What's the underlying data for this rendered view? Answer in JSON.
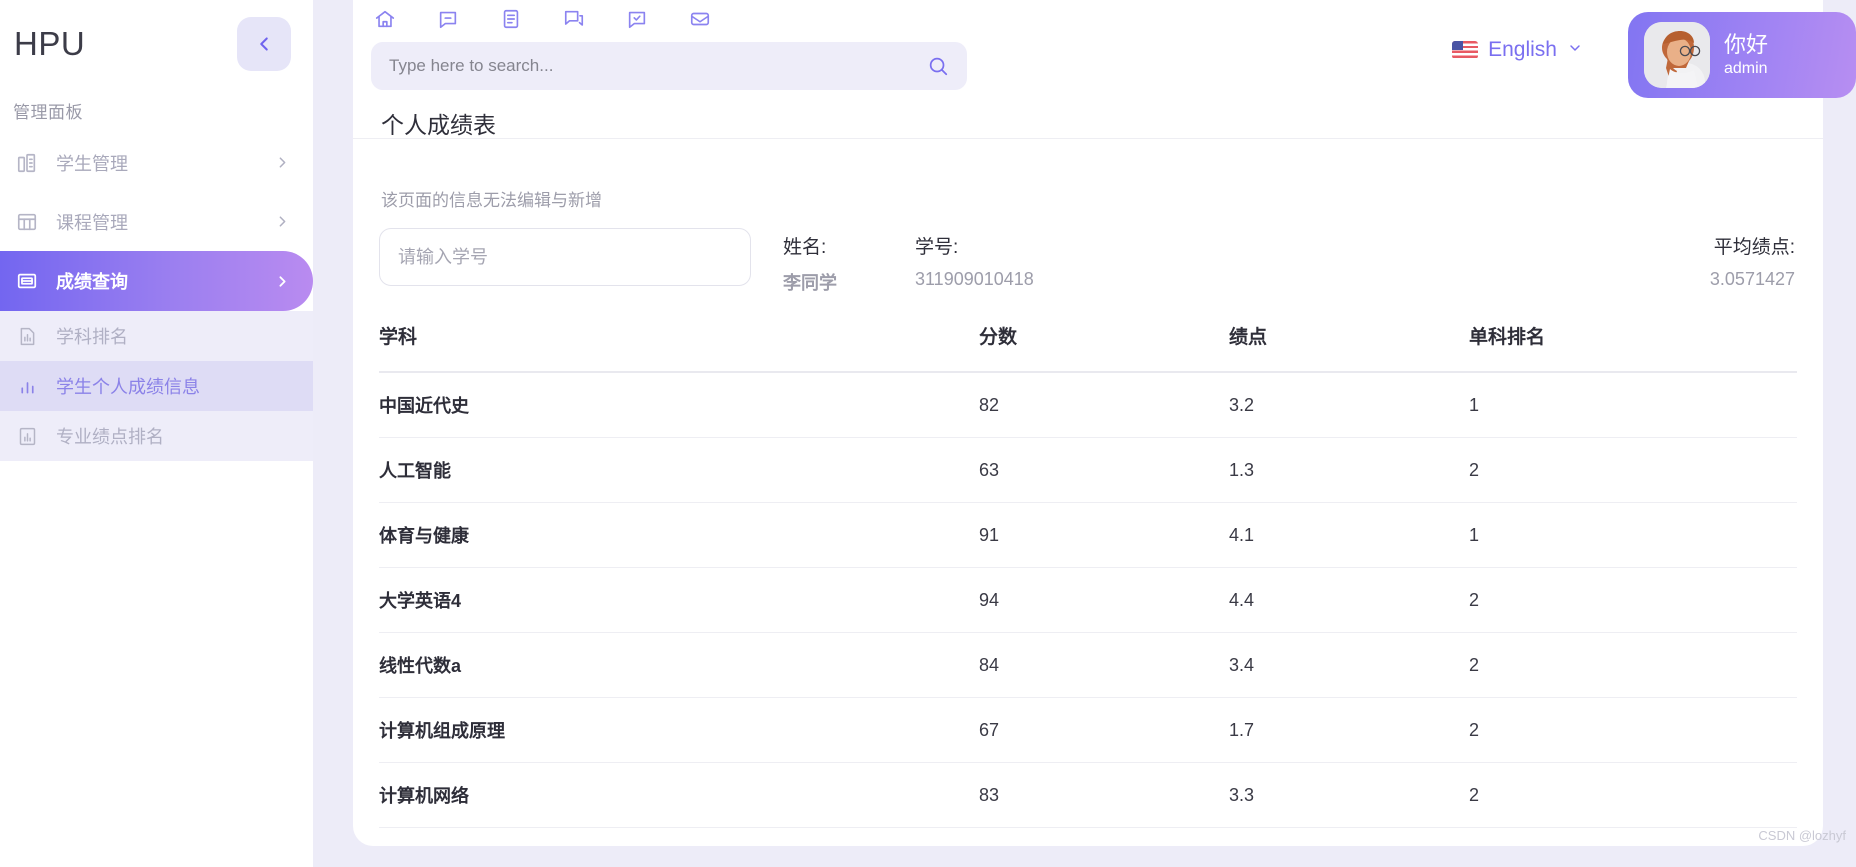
{
  "sidebar": {
    "brand": "HPU",
    "collapse_icon": "chevron-left-icon",
    "section_label": "管理面板",
    "items": [
      {
        "label": "学生管理",
        "icon": "building-chart-icon",
        "has_chevron": true,
        "state": "normal"
      },
      {
        "label": "课程管理",
        "icon": "table-icon",
        "has_chevron": true,
        "state": "normal"
      },
      {
        "label": "成绩查询",
        "icon": "id-card-icon",
        "has_chevron": true,
        "state": "active"
      }
    ],
    "sub_items": [
      {
        "label": "学科排名",
        "icon": "bar-chart-doc-icon",
        "state": "normal"
      },
      {
        "label": "学生个人成绩信息",
        "icon": "bar-chart-icon",
        "state": "current"
      },
      {
        "label": "专业绩点排名",
        "icon": "bar-chart-doc-icon",
        "state": "normal"
      }
    ]
  },
  "topnav": {
    "icons": [
      "home-icon",
      "comment-minus-icon",
      "document-list-icon",
      "chat-bubbles-icon",
      "comment-check-icon",
      "inbox-icon"
    ]
  },
  "header": {
    "search": {
      "placeholder": "Type here to search...",
      "value": "",
      "icon": "search-icon"
    },
    "language": {
      "label": "English",
      "flag": "us-flag-icon",
      "chevron": "chevron-down-icon"
    },
    "user": {
      "greeting": "你好",
      "name": "admin",
      "avatar": "user-avatar"
    }
  },
  "main": {
    "page_title": "个人成绩表",
    "notice": "该页面的信息无法编辑与新增",
    "student_id_input": {
      "placeholder": "请输入学号",
      "value": ""
    },
    "info": {
      "name_label": "姓名:",
      "name_value": "李同学",
      "sid_label": "学号:",
      "sid_value": "311909010418",
      "gpa_label": "平均绩点:",
      "gpa_value": "3.0571427"
    },
    "table": {
      "columns": [
        "学科",
        "分数",
        "绩点",
        "单科排名"
      ],
      "rows": [
        {
          "subject": "中国近代史",
          "score": "82",
          "gpa": "3.2",
          "rank": "1"
        },
        {
          "subject": "人工智能",
          "score": "63",
          "gpa": "1.3",
          "rank": "2"
        },
        {
          "subject": "体育与健康",
          "score": "91",
          "gpa": "4.1",
          "rank": "1"
        },
        {
          "subject": "大学英语4",
          "score": "94",
          "gpa": "4.4",
          "rank": "2"
        },
        {
          "subject": "线性代数a",
          "score": "84",
          "gpa": "3.4",
          "rank": "2"
        },
        {
          "subject": "计算机组成原理",
          "score": "67",
          "gpa": "1.7",
          "rank": "2"
        },
        {
          "subject": "计算机网络",
          "score": "83",
          "gpa": "3.3",
          "rank": "2"
        }
      ]
    }
  },
  "watermark": "CSDN @lozhyf",
  "colors": {
    "accent_start": "#7366f0",
    "accent_end": "#b98bf0",
    "icon_purple": "#8b83f0",
    "app_bg": "#edecf8",
    "sub_bg": "#eeedf9",
    "sub_current_bg": "#dedcf5"
  }
}
